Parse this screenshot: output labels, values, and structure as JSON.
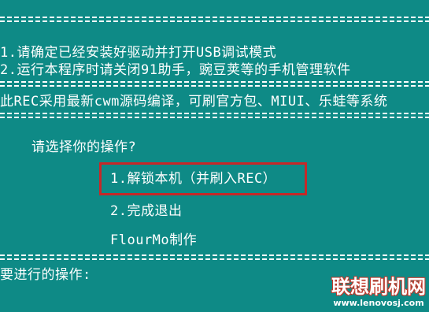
{
  "instructions": {
    "line1": "1.请确定已经安装好驱动并打开USB调试模式",
    "line2": "2.运行本程序时请关闭91助手，豌豆荚等的手机管理软件"
  },
  "notice": "此REC采用最新cwm源码编译，可刷官方包、MIUI、乐蛙等系统",
  "menu": {
    "prompt": "请选择你的操作?",
    "options": [
      "1.解锁本机（并刷入REC）",
      "2.完成退出"
    ],
    "credit": "FlourMo制作"
  },
  "input_prompt": "要进行的操作:",
  "watermark": {
    "title": "联想刷机网",
    "url": "www.lenovosj.com"
  },
  "colors": {
    "background": "#0e8a86",
    "text": "#ffffff",
    "highlight_border": "#c62828"
  }
}
